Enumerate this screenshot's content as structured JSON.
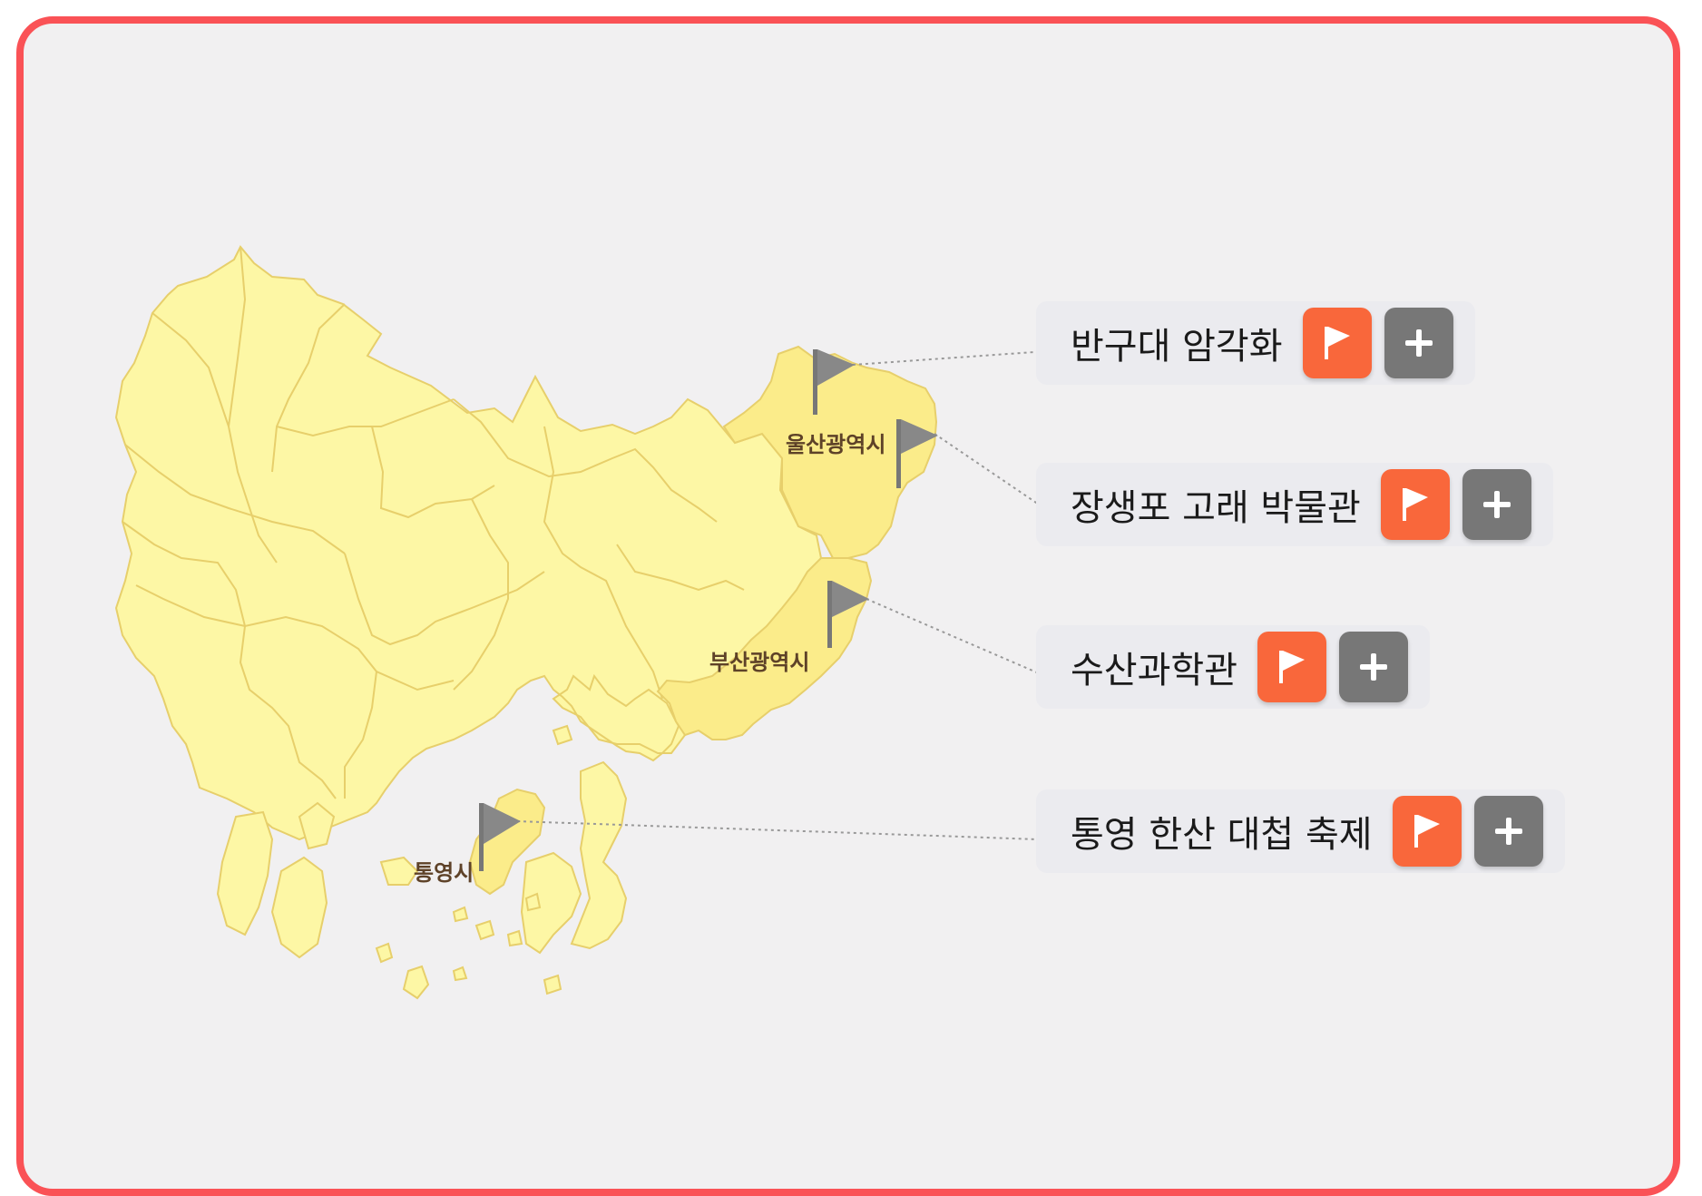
{
  "colors": {
    "frame_border": "#fa5256",
    "background": "#f1f0f1",
    "region_fill": "#fdf7a5",
    "highlight_fill": "#fbec8a",
    "region_stroke": "#e7cf6b",
    "flag_button": "#f9673b",
    "add_button": "#777777",
    "marker_flag": "#888888"
  },
  "map": {
    "labels": {
      "ulsan": "울산광역시",
      "busan": "부산광역시",
      "tongyeong": "통영시"
    }
  },
  "places": [
    {
      "title": "반구대 암각화",
      "flag_icon": "flag-icon",
      "add_icon": "plus-icon"
    },
    {
      "title": "장생포 고래 박물관",
      "flag_icon": "flag-icon",
      "add_icon": "plus-icon"
    },
    {
      "title": "수산과학관",
      "flag_icon": "flag-icon",
      "add_icon": "plus-icon"
    },
    {
      "title": "통영 한산 대첩 축제",
      "flag_icon": "flag-icon",
      "add_icon": "plus-icon"
    }
  ]
}
